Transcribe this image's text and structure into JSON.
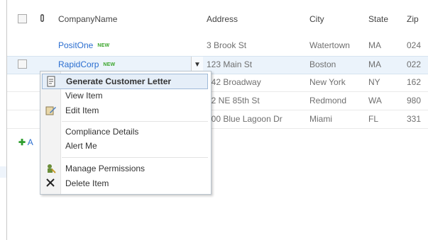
{
  "columns": {
    "company_name": "CompanyName",
    "address": "Address",
    "city": "City",
    "state": "State",
    "zip": "Zip"
  },
  "rows": [
    {
      "company": "PositOne",
      "is_new": true,
      "address": "3 Brook St",
      "city": "Watertown",
      "state": "MA",
      "zip": "024"
    },
    {
      "company": "RapidCorp",
      "is_new": true,
      "address": "123 Main St",
      "city": "Boston",
      "state": "MA",
      "zip": "022"
    },
    {
      "company": "",
      "is_new": false,
      "address": "242 Broadway",
      "city": "New York",
      "state": "NY",
      "zip": "162"
    },
    {
      "company": "",
      "is_new": false,
      "address": "12 NE 85th St",
      "city": "Redmond",
      "state": "WA",
      "zip": "980"
    },
    {
      "company": "",
      "is_new": false,
      "address": "500 Blue Lagoon Dr",
      "city": "Miami",
      "state": "FL",
      "zip": "331"
    }
  ],
  "new_tag": "NEW",
  "add_new": {
    "prefix": "A"
  },
  "menu": {
    "generate_letter": "Generate Customer Letter",
    "view_item": "View Item",
    "edit_item": "Edit Item",
    "compliance": "Compliance Details",
    "alert_me": "Alert Me",
    "manage_permissions": "Manage Permissions",
    "delete_item": "Delete Item"
  },
  "colors": {
    "link": "#2b6ed0",
    "header": "#1d5a8e",
    "selected_row": "#ebf3fb",
    "menu_highlight": "#e5eef8",
    "new_tag": "#3aa52a"
  },
  "icons": {
    "attachment_header": "paperclip-icon",
    "generate_letter": "document-icon",
    "edit_item": "edit-icon",
    "manage_permissions": "permissions-icon",
    "delete_item": "delete-x-icon",
    "add_new": "plus-icon",
    "item_menu": "chevron-down-icon"
  }
}
